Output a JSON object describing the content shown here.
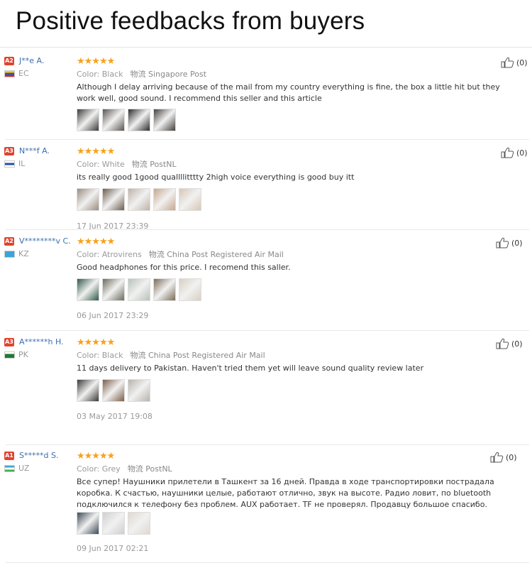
{
  "title": "Positive feedbacks from buyers",
  "reviews": [
    {
      "level": "A2",
      "user": "J**e A.",
      "country": "EC",
      "stars": "★★★★★",
      "color": "Color: Black",
      "shipping": "物流 Singapore Post",
      "text": "Although I delay arriving because of the mail from my country everything is fine, the box a little hit but they work well, good sound. I recommend this seller and this article",
      "date": "",
      "helpful": "(0)",
      "flag_colors": [
        "#f5d000",
        "#2a55b5",
        "#d3262d"
      ],
      "photo_colors": [
        "#3b3a38",
        "#5a5450",
        "#2b2b2b",
        "#44403c"
      ]
    },
    {
      "level": "A3",
      "user": "N***f A.",
      "country": "IL",
      "stars": "★★★★★",
      "color": "Color: White",
      "shipping": "物流 PostNL",
      "text": "its really good 1good quallllitttty 2high voice everything is good buy itt",
      "date": "17 Jun 2017 23:39",
      "helpful": "(0)",
      "flag_colors": [
        "#ffffff",
        "#1f4fa8",
        "#ffffff"
      ],
      "photo_colors": [
        "#9a8c7e",
        "#6d5c4d",
        "#bfb2a6",
        "#c7a78c",
        "#d8c6b4"
      ]
    },
    {
      "level": "A2",
      "user": "V********v C.",
      "country": "KZ",
      "stars": "★★★★★",
      "color": "Color: Atrovirens",
      "shipping": "物流 China Post Registered Air Mail",
      "text": "Good headphones for this price. I recomend this saller.",
      "date": "06 Jun 2017 23:29",
      "helpful": "(0)",
      "flag_colors": [
        "#3aa4d8",
        "#3aa4d8",
        "#3aa4d8"
      ],
      "photo_colors": [
        "#2e5a48",
        "#6b6b5c",
        "#b6c2b8",
        "#7b6b58",
        "#d8d0c2"
      ]
    },
    {
      "level": "A3",
      "user": "A******h H.",
      "country": "PK",
      "stars": "★★★★★",
      "color": "Color: Black",
      "shipping": "物流 China Post Registered Air Mail",
      "text": "11 days delivery to Pakistan. Haven't tried them yet will leave sound quality review later",
      "date": "03 May 2017 19:08",
      "helpful": "(0)",
      "flag_colors": [
        "#ffffff",
        "#1e7a34",
        "#1e7a34"
      ],
      "photo_colors": [
        "#3a3836",
        "#7c5e4a",
        "#b8b2ac"
      ]
    },
    {
      "level": "A1",
      "user": "S*****d S.",
      "country": "UZ",
      "stars": "★★★★★",
      "color": "Color: Grey",
      "shipping": "物流 PostNL",
      "text": "Все супер! Наушники прилетели в Ташкент за 16 дней. Правда в ходе транспортировки пострадала коробка. К счастью, наушники целые, работают отлично, звук на высоте. Радио ловит, по bluetooth подключился к телефону без проблем. AUX работает. TF не проверял. Продавцу большое спасибо.",
      "date": "09 Jun 2017 02:21",
      "helpful": "(0)",
      "flag_colors": [
        "#3ea7d6",
        "#ffffff",
        "#3fae49"
      ],
      "photo_colors": [
        "#3d4a55",
        "#cfcfcf",
        "#ded8cf"
      ]
    }
  ]
}
